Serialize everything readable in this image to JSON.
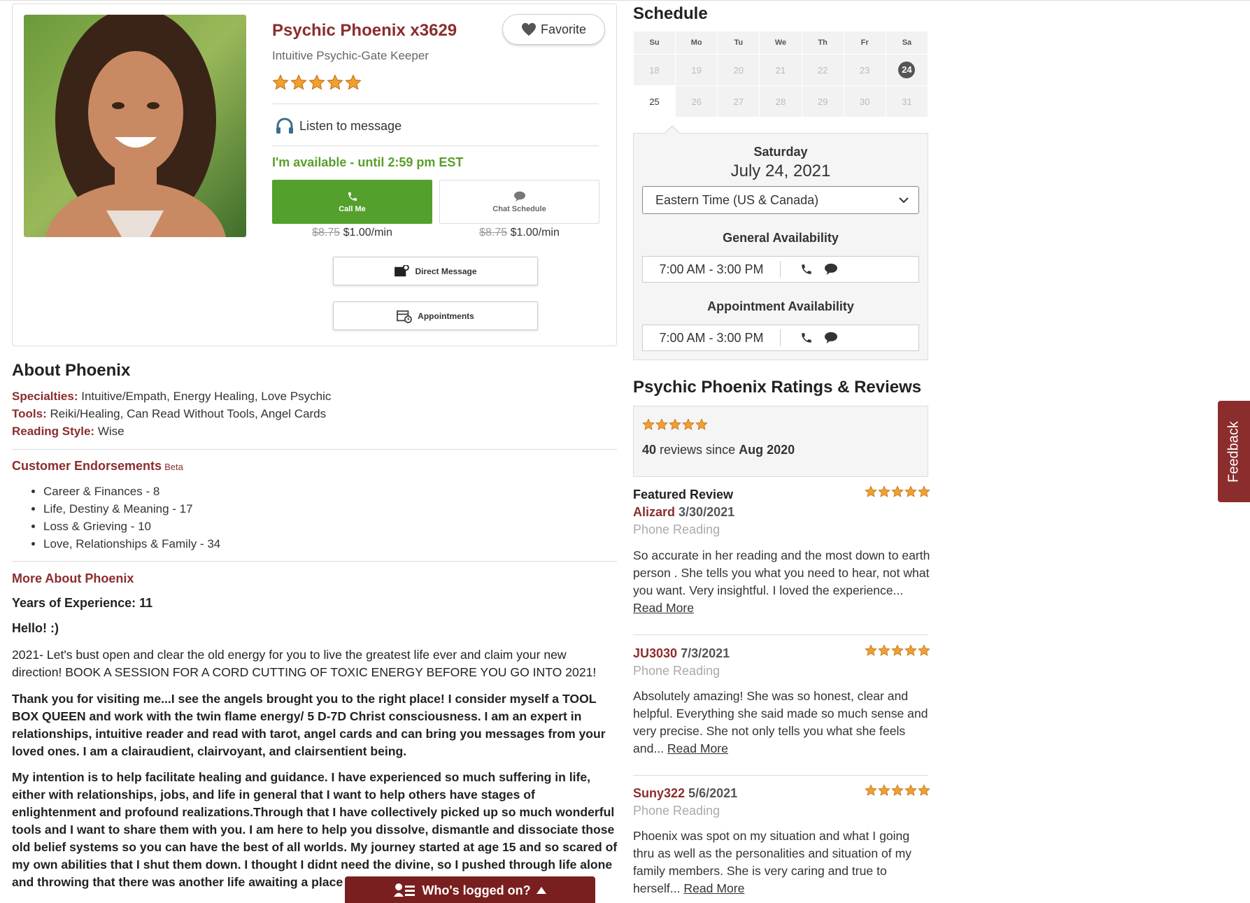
{
  "profile": {
    "name": "Psychic Phoenix x3629",
    "title": "Intuitive Psychic-Gate Keeper",
    "rating_stars": 5,
    "favorite_label": "Favorite",
    "listen_label": "Listen to message",
    "availability": "I'm available - until 2:59 pm EST",
    "call": {
      "label": "Call Me",
      "old_price": "$8.75",
      "price": "$1.00/min"
    },
    "chat": {
      "label": "Chat Schedule",
      "old_price": "$8.75",
      "price": "$1.00/min"
    },
    "direct_message_label": "Direct Message",
    "appointments_label": "Appointments"
  },
  "about": {
    "heading": "About Phoenix",
    "specialties_label": "Specialties:",
    "specialties": "Intuitive/Empath, Energy Healing, Love Psychic",
    "tools_label": "Tools:",
    "tools": "Reiki/Healing, Can Read Without Tools, Angel Cards",
    "style_label": "Reading Style:",
    "style": "Wise",
    "endorsements_heading": "Customer Endorsements",
    "endorsements_beta": "Beta",
    "endorsements": [
      "Career & Finances - 8",
      "Life, Destiny & Meaning - 17",
      "Loss & Grieving - 10",
      "Love, Relationships & Family - 34"
    ],
    "more_heading": "More About Phoenix",
    "years": "Years of Experience: 11",
    "hello": "Hello! :)",
    "p1": "2021- Let's bust open  and clear the old energy for you to live the greatest life ever and claim your new direction! BOOK A SESSION FOR A CORD CUTTING OF TOXIC ENERGY BEFORE YOU GO INTO 2021!",
    "p2": "Thank you for visiting me...I see the angels brought you to the right place! I consider myself a TOOL BOX QUEEN and work with the twin flame energy/ 5 D-7D Christ consciousness. I am an expert in relationships, intuitive reader and read with tarot, angel cards and can bring you messages from your loved ones. I am a clairaudient, clairvoyant, and clairsentient being.",
    "p3": "My intention is to help facilitate healing and guidance. I have experienced so much suffering in life, either with relationships, jobs, and life in general that I want to help others have stages of enlightenment and profound realizations.Through that I have collectively picked up so much wonderful tools and I want to share them with you. I am here to help you dissolve, dismantle and dissociate those old belief systems so you can have the best of all worlds. My journey started at age 15 and so scared of my own abilities that I shut them down. I thought I didnt need the divine, so I pushed through life alone and throwing that there was another life awaiting a place"
  },
  "logged_on": {
    "label": "Who's logged on?"
  },
  "schedule": {
    "heading": "Schedule",
    "days": [
      "Su",
      "Mo",
      "Tu",
      "We",
      "Th",
      "Fr",
      "Sa"
    ],
    "week1": [
      "18",
      "19",
      "20",
      "21",
      "22",
      "23",
      "24"
    ],
    "week2": [
      "25",
      "26",
      "27",
      "28",
      "29",
      "30",
      "31"
    ],
    "selected_weekday": "Saturday",
    "selected_date": "July 24, 2021",
    "timezone": "Eastern Time (US & Canada)",
    "general_heading": "General Availability",
    "general_slot": "7:00 AM - 3:00 PM",
    "appointment_heading": "Appointment Availability",
    "appointment_slot": "7:00 AM - 3:00 PM"
  },
  "reviews": {
    "heading": "Psychic Phoenix Ratings & Reviews",
    "count": "40",
    "count_text": "reviews since",
    "since": "Aug 2020",
    "featured_label": "Featured Review",
    "read_more": "Read More",
    "items": [
      {
        "name": "Alizard",
        "date": "3/30/2021",
        "type": "Phone Reading",
        "text": "So accurate in her reading and the most down to earth person . She tells you what you need to hear, not what you want. Very insightful. I loved the experience..."
      },
      {
        "name": "JU3030",
        "date": "7/3/2021",
        "type": "Phone Reading",
        "text": "Absolutely amazing! She was so honest, clear and helpful. Everything she said made so much sense and very precise. She not only tells you what she feels and..."
      },
      {
        "name": "Suny322",
        "date": "5/6/2021",
        "type": "Phone Reading",
        "text": "Phoenix was spot on my situation and what I going thru as well as the personalities and situation of my family members. She is very caring and true to herself..."
      }
    ]
  },
  "feedback_label": "Feedback",
  "colors": {
    "accent": "#8b2d2d",
    "green": "#53a02c",
    "star": "#f0a030"
  }
}
